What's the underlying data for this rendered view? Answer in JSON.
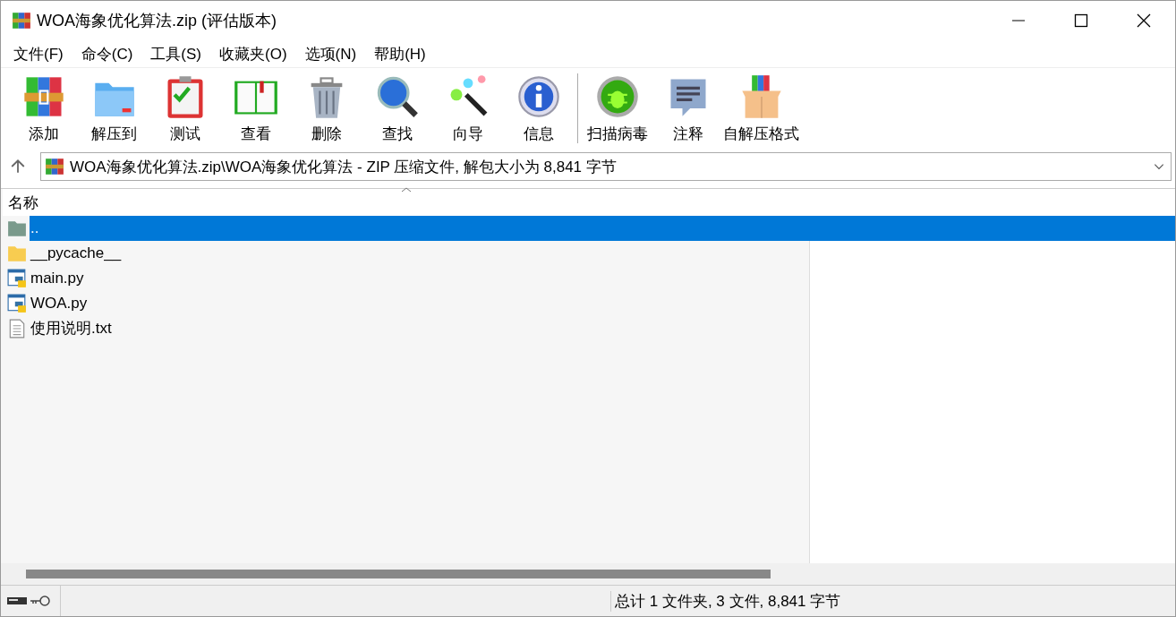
{
  "window": {
    "title": "WOA海象优化算法.zip (评估版本)"
  },
  "menu": [
    "文件(F)",
    "命令(C)",
    "工具(S)",
    "收藏夹(O)",
    "选项(N)",
    "帮助(H)"
  ],
  "toolbar": [
    {
      "label": "添加"
    },
    {
      "label": "解压到"
    },
    {
      "label": "测试"
    },
    {
      "label": "查看"
    },
    {
      "label": "删除"
    },
    {
      "label": "查找"
    },
    {
      "label": "向导"
    },
    {
      "label": "信息"
    },
    {
      "label": "扫描病毒"
    },
    {
      "label": "注释"
    },
    {
      "label": "自解压格式"
    }
  ],
  "address": {
    "value": "WOA海象优化算法.zip\\WOA海象优化算法 - ZIP 压缩文件, 解包大小为 8,841 字节"
  },
  "table": {
    "columns": [
      "名称"
    ],
    "rows": [
      {
        "name": "..",
        "kind": "up",
        "selected": true
      },
      {
        "name": "__pycache__",
        "kind": "folder",
        "selected": false
      },
      {
        "name": "main.py",
        "kind": "python",
        "selected": false
      },
      {
        "name": "WOA.py",
        "kind": "python",
        "selected": false
      },
      {
        "name": "使用说明.txt",
        "kind": "text",
        "selected": false
      }
    ]
  },
  "status_bar": {
    "summary": "总计 1 文件夹, 3 文件, 8,841 字节"
  }
}
